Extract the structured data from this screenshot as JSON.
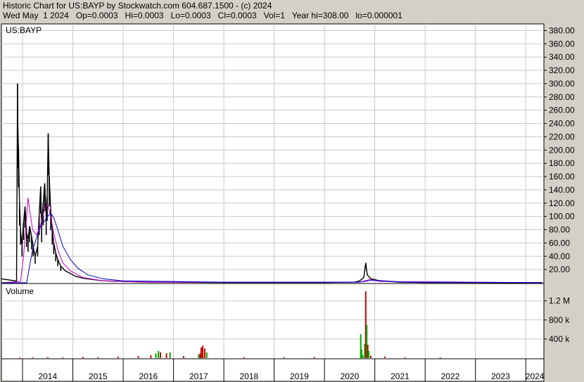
{
  "header": {
    "line1": "Historic Chart for US:BAYP by Stockwatch.com 604.687.1500 - (c) 2024",
    "line2": "Wed May  1 2024   Op=0.0003   Hi=0.0003   Lo=0.0003   Cl=0.0003   Vol=1   Year hi=308.00   lo=0.000001"
  },
  "chart_data": [
    {
      "type": "candlestick",
      "panel": "price",
      "title": "US:BAYP",
      "y_ticks": [
        "20.00",
        "40.00",
        "60.00",
        "80.00",
        "100.00",
        "120.00",
        "140.00",
        "160.00",
        "180.00",
        "200.00",
        "220.00",
        "240.00",
        "260.00",
        "280.00",
        "300.00",
        "320.00",
        "340.00",
        "360.00",
        "380.00"
      ],
      "ylim": [
        0,
        390
      ],
      "x_ticks": [
        "2014",
        "2015",
        "2016",
        "2017",
        "2018",
        "2019",
        "2020",
        "2021",
        "2022",
        "2023",
        "2024"
      ],
      "xlim": [
        2013.58,
        2024.36
      ],
      "grid": true,
      "series": [
        {
          "role": "price",
          "color": "#000000",
          "points": [
            {
              "x": 2013.58,
              "y": 6
            },
            {
              "x": 2013.85,
              "y": 3
            },
            {
              "x": 2013.88,
              "y": 2
            },
            {
              "x": 2013.9,
              "y": 300
            },
            {
              "x": 2013.905,
              "y": 240
            },
            {
              "x": 2013.92,
              "y": 200
            },
            {
              "x": 2013.94,
              "y": 120
            },
            {
              "x": 2013.96,
              "y": 80
            },
            {
              "x": 2013.99,
              "y": 55
            },
            {
              "x": 2014.02,
              "y": 90
            },
            {
              "x": 2014.05,
              "y": 115
            },
            {
              "x": 2014.08,
              "y": 75
            },
            {
              "x": 2014.11,
              "y": 65
            },
            {
              "x": 2014.14,
              "y": 85
            },
            {
              "x": 2014.18,
              "y": 70
            },
            {
              "x": 2014.21,
              "y": 55
            },
            {
              "x": 2014.25,
              "y": 40
            },
            {
              "x": 2014.3,
              "y": 55
            },
            {
              "x": 2014.33,
              "y": 100
            },
            {
              "x": 2014.36,
              "y": 145
            },
            {
              "x": 2014.38,
              "y": 85
            },
            {
              "x": 2014.41,
              "y": 120
            },
            {
              "x": 2014.44,
              "y": 150
            },
            {
              "x": 2014.47,
              "y": 100
            },
            {
              "x": 2014.49,
              "y": 130
            },
            {
              "x": 2014.51,
              "y": 225
            },
            {
              "x": 2014.53,
              "y": 160
            },
            {
              "x": 2014.56,
              "y": 110
            },
            {
              "x": 2014.59,
              "y": 80
            },
            {
              "x": 2014.62,
              "y": 60
            },
            {
              "x": 2014.66,
              "y": 45
            },
            {
              "x": 2014.7,
              "y": 35
            },
            {
              "x": 2014.76,
              "y": 25
            },
            {
              "x": 2014.85,
              "y": 18
            },
            {
              "x": 2014.95,
              "y": 14
            },
            {
              "x": 2015.05,
              "y": 10
            },
            {
              "x": 2015.2,
              "y": 7
            },
            {
              "x": 2015.4,
              "y": 5
            },
            {
              "x": 2015.6,
              "y": 3
            },
            {
              "x": 2016.0,
              "y": 2
            },
            {
              "x": 2016.5,
              "y": 1
            },
            {
              "x": 2017.0,
              "y": 1
            },
            {
              "x": 2018.0,
              "y": 0.5
            },
            {
              "x": 2019.0,
              "y": 0.5
            },
            {
              "x": 2020.0,
              "y": 0.5
            },
            {
              "x": 2020.6,
              "y": 1
            },
            {
              "x": 2020.7,
              "y": 3
            },
            {
              "x": 2020.78,
              "y": 8
            },
            {
              "x": 2020.82,
              "y": 30
            },
            {
              "x": 2020.85,
              "y": 12
            },
            {
              "x": 2020.92,
              "y": 6
            },
            {
              "x": 2021.1,
              "y": 3
            },
            {
              "x": 2021.5,
              "y": 1
            },
            {
              "x": 2022.0,
              "y": 0.5
            },
            {
              "x": 2023.0,
              "y": 0.3
            },
            {
              "x": 2024.0,
              "y": 0.2
            },
            {
              "x": 2024.33,
              "y": 0.1
            }
          ]
        },
        {
          "role": "moving-average-short",
          "color": "#cc00cc",
          "points": [
            {
              "x": 2013.58,
              "y": 0
            },
            {
              "x": 2013.96,
              "y": 2
            },
            {
              "x": 2014.02,
              "y": 40
            },
            {
              "x": 2014.08,
              "y": 100
            },
            {
              "x": 2014.11,
              "y": 128
            },
            {
              "x": 2014.14,
              "y": 110
            },
            {
              "x": 2014.2,
              "y": 80
            },
            {
              "x": 2014.28,
              "y": 72
            },
            {
              "x": 2014.36,
              "y": 88
            },
            {
              "x": 2014.44,
              "y": 112
            },
            {
              "x": 2014.5,
              "y": 118
            },
            {
              "x": 2014.56,
              "y": 100
            },
            {
              "x": 2014.62,
              "y": 75
            },
            {
              "x": 2014.7,
              "y": 50
            },
            {
              "x": 2014.8,
              "y": 30
            },
            {
              "x": 2014.95,
              "y": 18
            },
            {
              "x": 2015.2,
              "y": 8
            },
            {
              "x": 2015.6,
              "y": 3
            },
            {
              "x": 2016.5,
              "y": 1
            },
            {
              "x": 2020.7,
              "y": 1
            },
            {
              "x": 2020.9,
              "y": 5
            },
            {
              "x": 2021.1,
              "y": 2
            },
            {
              "x": 2024.33,
              "y": 0.2
            }
          ]
        },
        {
          "role": "moving-average-long",
          "color": "#0000cc",
          "points": [
            {
              "x": 2013.58,
              "y": 0
            },
            {
              "x": 2014.08,
              "y": 0
            },
            {
              "x": 2014.2,
              "y": 50
            },
            {
              "x": 2014.36,
              "y": 85
            },
            {
              "x": 2014.5,
              "y": 100
            },
            {
              "x": 2014.56,
              "y": 105
            },
            {
              "x": 2014.62,
              "y": 98
            },
            {
              "x": 2014.7,
              "y": 80
            },
            {
              "x": 2014.8,
              "y": 55
            },
            {
              "x": 2014.95,
              "y": 35
            },
            {
              "x": 2015.1,
              "y": 22
            },
            {
              "x": 2015.3,
              "y": 12
            },
            {
              "x": 2015.6,
              "y": 6
            },
            {
              "x": 2016.0,
              "y": 3
            },
            {
              "x": 2017.0,
              "y": 2
            },
            {
              "x": 2018.0,
              "y": 1
            },
            {
              "x": 2020.7,
              "y": 1
            },
            {
              "x": 2020.95,
              "y": 4
            },
            {
              "x": 2021.2,
              "y": 3
            },
            {
              "x": 2021.6,
              "y": 1
            },
            {
              "x": 2024.33,
              "y": 0.3
            }
          ]
        }
      ]
    },
    {
      "type": "bar",
      "panel": "volume",
      "title": "Volume",
      "y_ticks": [
        "400 k",
        "800 k",
        "1.2 M"
      ],
      "y_tick_values": [
        400000,
        800000,
        1200000
      ],
      "ylim": [
        0,
        1550000
      ],
      "grid": true,
      "colors": {
        "up": "#00aa00",
        "down": "#cc0000"
      },
      "bars": [
        {
          "x": 2013.95,
          "v": 10000,
          "c": "down"
        },
        {
          "x": 2014.2,
          "v": 15000,
          "c": "down"
        },
        {
          "x": 2014.5,
          "v": 20000,
          "c": "down"
        },
        {
          "x": 2014.8,
          "v": 12000,
          "c": "down"
        },
        {
          "x": 2015.2,
          "v": 25000,
          "c": "down"
        },
        {
          "x": 2015.5,
          "v": 18000,
          "c": "down"
        },
        {
          "x": 2015.9,
          "v": 30000,
          "c": "down"
        },
        {
          "x": 2016.3,
          "v": 40000,
          "c": "down"
        },
        {
          "x": 2016.55,
          "v": 60000,
          "c": "down"
        },
        {
          "x": 2016.65,
          "v": 100000,
          "c": "up"
        },
        {
          "x": 2016.7,
          "v": 150000,
          "c": "up"
        },
        {
          "x": 2016.74,
          "v": 120000,
          "c": "down"
        },
        {
          "x": 2016.86,
          "v": 100000,
          "c": "down"
        },
        {
          "x": 2016.93,
          "v": 120000,
          "c": "up"
        },
        {
          "x": 2017.2,
          "v": 40000,
          "c": "down"
        },
        {
          "x": 2017.5,
          "v": 80000,
          "c": "up"
        },
        {
          "x": 2017.53,
          "v": 100000,
          "c": "down"
        },
        {
          "x": 2017.55,
          "v": 220000,
          "c": "down"
        },
        {
          "x": 2017.58,
          "v": 260000,
          "c": "down"
        },
        {
          "x": 2017.62,
          "v": 200000,
          "c": "down"
        },
        {
          "x": 2017.66,
          "v": 120000,
          "c": "up"
        },
        {
          "x": 2018.4,
          "v": 20000,
          "c": "down"
        },
        {
          "x": 2019.2,
          "v": 15000,
          "c": "down"
        },
        {
          "x": 2019.8,
          "v": 20000,
          "c": "down"
        },
        {
          "x": 2020.72,
          "v": 500000,
          "c": "up"
        },
        {
          "x": 2020.74,
          "v": 180000,
          "c": "up"
        },
        {
          "x": 2020.76,
          "v": 60000,
          "c": "up"
        },
        {
          "x": 2020.8,
          "v": 300000,
          "c": "up"
        },
        {
          "x": 2020.82,
          "v": 1400000,
          "c": "down"
        },
        {
          "x": 2020.84,
          "v": 700000,
          "c": "up"
        },
        {
          "x": 2020.86,
          "v": 280000,
          "c": "down"
        },
        {
          "x": 2020.88,
          "v": 150000,
          "c": "up"
        },
        {
          "x": 2020.92,
          "v": 50000,
          "c": "down"
        },
        {
          "x": 2021.2,
          "v": 30000,
          "c": "down"
        },
        {
          "x": 2021.6,
          "v": 15000,
          "c": "down"
        },
        {
          "x": 2022.3,
          "v": 10000,
          "c": "down"
        }
      ]
    }
  ]
}
